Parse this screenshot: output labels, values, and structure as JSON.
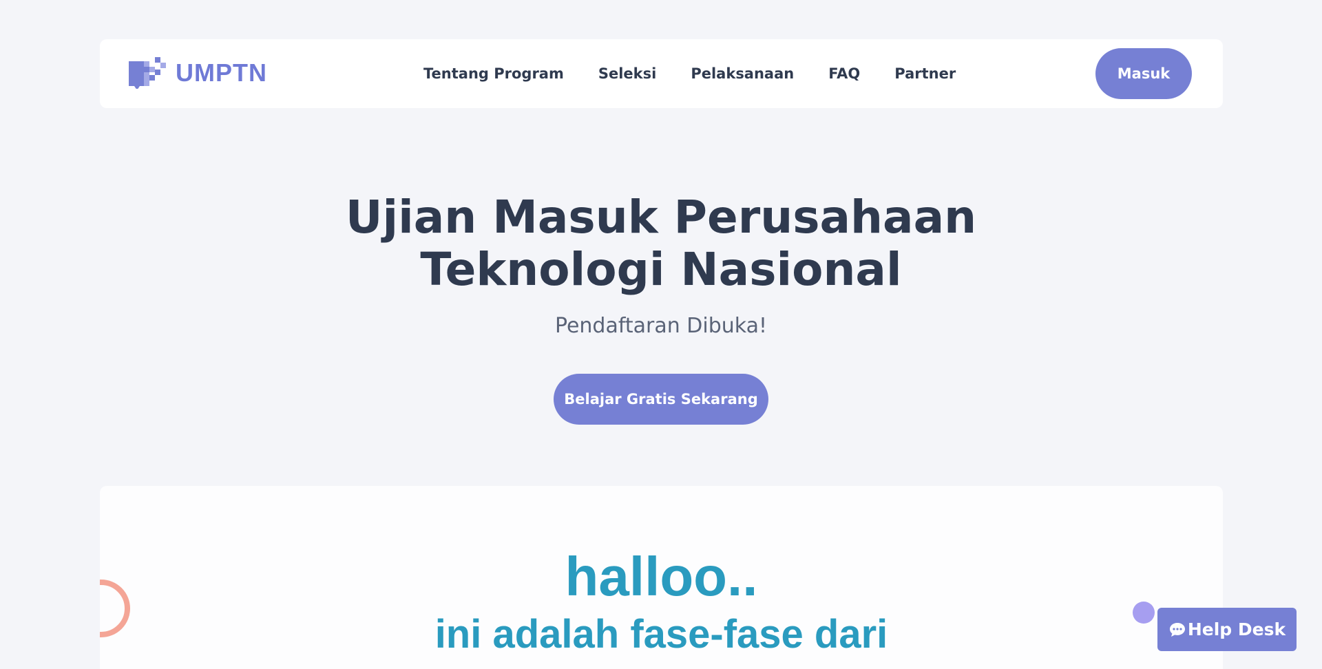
{
  "header": {
    "logo_text": "UMPTN",
    "nav": [
      {
        "label": "Tentang Program"
      },
      {
        "label": "Seleksi"
      },
      {
        "label": "Pelaksanaan"
      },
      {
        "label": "FAQ"
      },
      {
        "label": "Partner"
      }
    ],
    "login_label": "Masuk"
  },
  "hero": {
    "title_line1": "Ujian Masuk Perusahaan",
    "title_line2": "Teknologi Nasional",
    "subtitle": "Pendaftaran Dibuka!",
    "cta_label": "Belajar Gratis Sekarang"
  },
  "phases": {
    "title": "halloo..",
    "subtitle": "ini adalah fase-fase dari"
  },
  "help": {
    "label": "Help Desk",
    "icon": "chat-icon"
  },
  "colors": {
    "primary": "#7680d4",
    "accent_text": "#2a9bbf",
    "ring": "#f4a596",
    "background": "#f4f5f9"
  }
}
